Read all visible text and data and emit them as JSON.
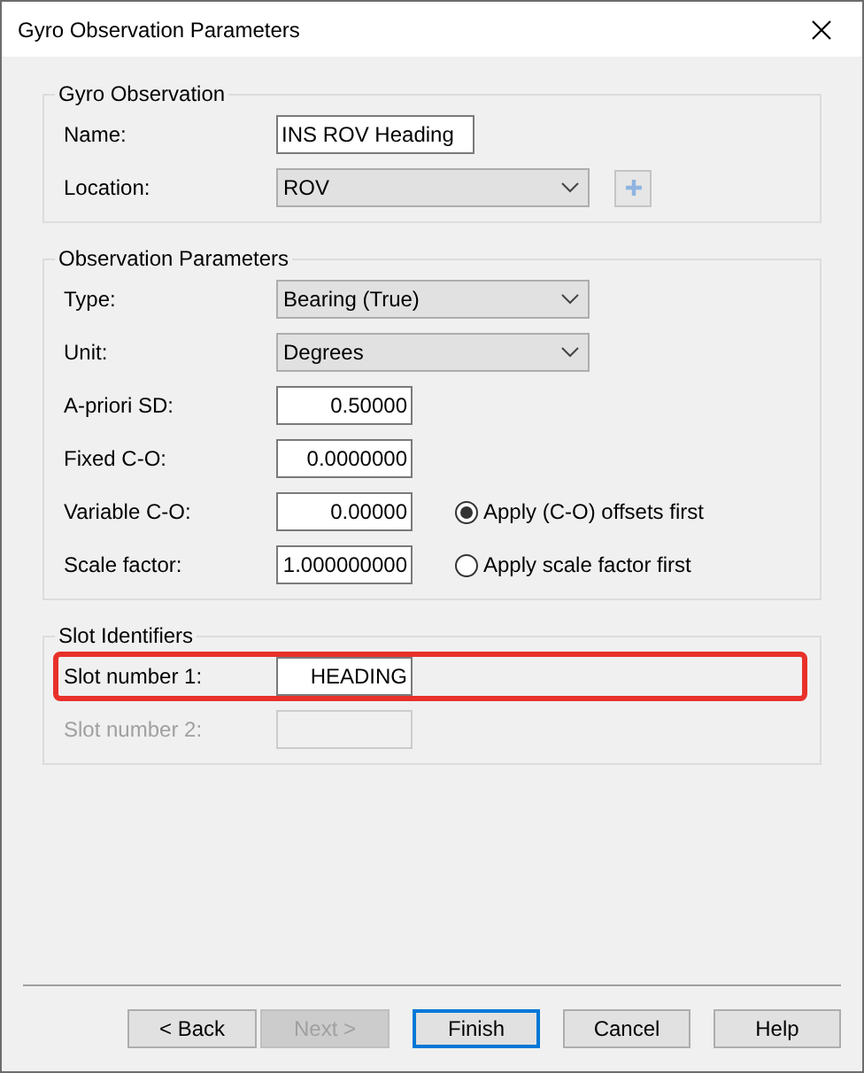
{
  "window": {
    "title": "Gyro Observation Parameters"
  },
  "groups": [
    {
      "title": "Gyro Observation",
      "rows": [
        {
          "kind": "text",
          "label": "Name:",
          "value": "INS ROV Heading"
        },
        {
          "kind": "dropdown_add",
          "label": "Location:",
          "value": "ROV"
        }
      ]
    },
    {
      "title": "Observation Parameters",
      "rows": [
        {
          "kind": "dropdown",
          "label": "Type:",
          "value": "Bearing (True)"
        },
        {
          "kind": "dropdown",
          "label": "Unit:",
          "value": "Degrees"
        },
        {
          "kind": "number",
          "label": "A-priori SD:",
          "value": "0.50000"
        },
        {
          "kind": "number",
          "label": "Fixed C-O:",
          "value": "0.0000000"
        },
        {
          "kind": "number",
          "label": "Variable C-O:",
          "value": "0.00000",
          "option": {
            "label": "Apply (C-O) offsets first",
            "selected": true
          }
        },
        {
          "kind": "number",
          "label": "Scale factor:",
          "value": "1.000000000",
          "option": {
            "label": "Apply scale factor first",
            "selected": false
          }
        }
      ]
    },
    {
      "title": "Slot Identifiers",
      "rows": [
        {
          "kind": "number",
          "label": "Slot number 1:",
          "value": "HEADING",
          "highlighted": true,
          "disabled": false
        },
        {
          "kind": "number",
          "label": "Slot number 2:",
          "value": "",
          "highlighted": false,
          "disabled": true
        }
      ]
    }
  ],
  "nav_buttons": [
    {
      "label": "< Back",
      "disabled": false
    },
    {
      "label": "Next >",
      "disabled": true
    }
  ],
  "buttons": [
    {
      "label": "Finish",
      "focused": true
    },
    {
      "label": "Cancel",
      "focused": false
    },
    {
      "label": "Help",
      "focused": false
    }
  ]
}
